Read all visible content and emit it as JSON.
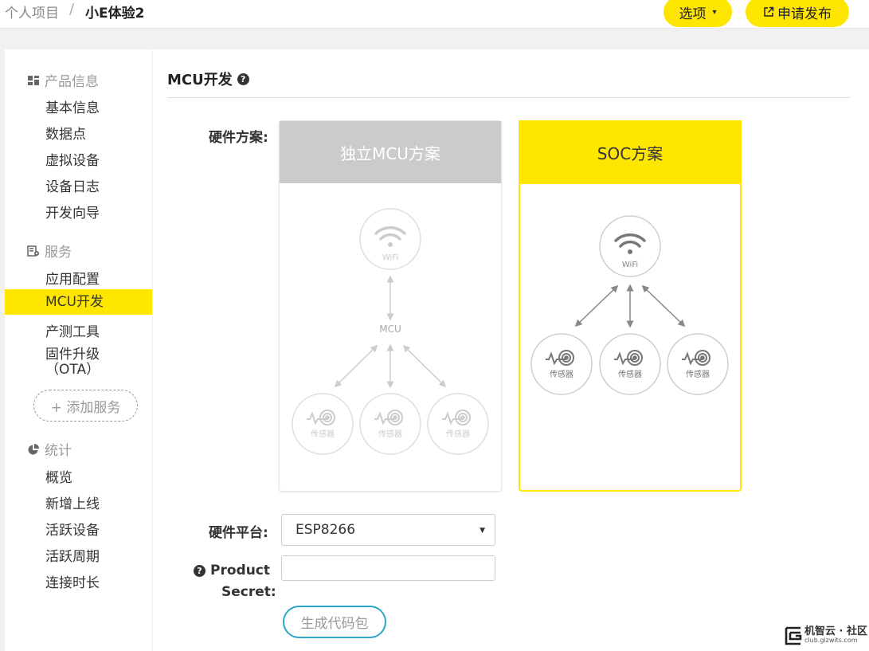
{
  "breadcrumb": {
    "root": "个人项目",
    "separator": "/",
    "current": "小E体验2"
  },
  "header": {
    "options_label": "选项",
    "options_caret": "▾",
    "publish_label": "申请发布"
  },
  "sidebar": {
    "product_section": "产品信息",
    "product_items": [
      "基本信息",
      "数据点",
      "虚拟设备",
      "设备日志",
      "开发向导"
    ],
    "service_section": "服务",
    "service_items": [
      "应用配置",
      "MCU开发",
      "产测工具"
    ],
    "firmware_label": "固件升级",
    "firmware_sub": "（OTA）",
    "add_service": "+ 添加服务",
    "stats_section": "统计",
    "stats_items": [
      "概览",
      "新增上线",
      "活跃设备",
      "活跃周期",
      "连接时长"
    ]
  },
  "main": {
    "title": "MCU开发",
    "hardware_scheme_label": "硬件方案:",
    "schemes": [
      {
        "title": "独立MCU方案",
        "selected": false
      },
      {
        "title": "SOC方案",
        "selected": true
      }
    ],
    "diagram": {
      "wifi": "WiFi",
      "mcu": "MCU",
      "sensor": "传感器"
    },
    "platform_label": "硬件平台:",
    "platform_value": "ESP8266",
    "product_secret_label": "Product",
    "product_secret_label2": "Secret:",
    "product_secret_value": "",
    "generate_button": "生成代码包"
  },
  "watermark": {
    "text": "机智云 · 社区",
    "url": "club.gizwits.com"
  },
  "colors": {
    "accent": "#ffe600",
    "button_border": "#2aa6c7",
    "disabled_header": "#cbcbcb"
  }
}
